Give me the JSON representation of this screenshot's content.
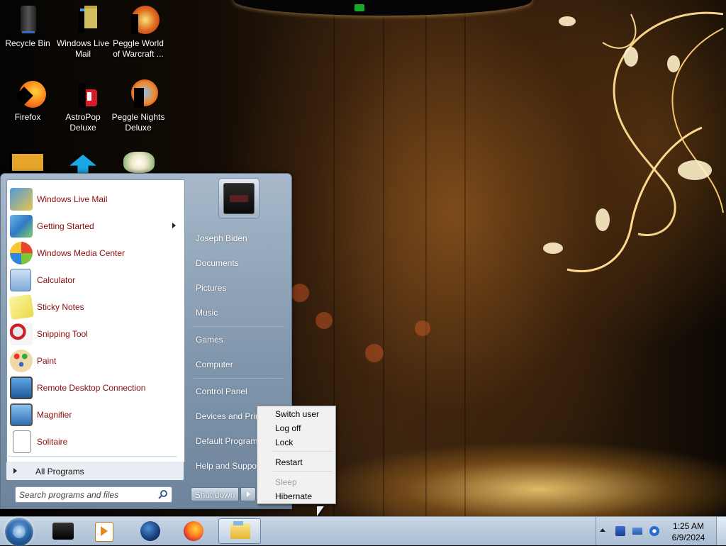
{
  "desktop": {
    "icons": [
      {
        "label": "Recycle Bin",
        "icon": "recycle-bin-icon"
      },
      {
        "label": "Windows Live\nMail",
        "icon": "windows-live-mail-icon"
      },
      {
        "label": "Peggle World\nof Warcraft ...",
        "icon": "peggle-wow-icon"
      },
      {
        "label": "Firefox",
        "icon": "firefox-icon"
      },
      {
        "label": "AstroPop\nDeluxe",
        "icon": "astropop-icon"
      },
      {
        "label": "Peggle Nights\nDeluxe",
        "icon": "peggle-nights-icon"
      }
    ]
  },
  "start_menu": {
    "programs": [
      {
        "label": "Windows Live Mail",
        "icon": "windows-live-mail-icon",
        "submenu": false
      },
      {
        "label": "Getting Started",
        "icon": "getting-started-icon",
        "submenu": true
      },
      {
        "label": "Windows Media Center",
        "icon": "media-center-icon",
        "submenu": false
      },
      {
        "label": "Calculator",
        "icon": "calculator-icon",
        "submenu": false
      },
      {
        "label": "Sticky Notes",
        "icon": "sticky-notes-icon",
        "submenu": false
      },
      {
        "label": "Snipping Tool",
        "icon": "snipping-tool-icon",
        "submenu": false
      },
      {
        "label": "Paint",
        "icon": "paint-icon",
        "submenu": false
      },
      {
        "label": "Remote Desktop Connection",
        "icon": "remote-desktop-icon",
        "submenu": false
      },
      {
        "label": "Magnifier",
        "icon": "magnifier-icon",
        "submenu": false
      },
      {
        "label": "Solitaire",
        "icon": "solitaire-icon",
        "submenu": false
      }
    ],
    "all_programs_label": "All Programs",
    "search_placeholder": "Search programs and files",
    "right_links": [
      "Joseph Biden",
      "Documents",
      "Pictures",
      "Music",
      "Games",
      "Computer",
      "Control Panel",
      "Devices and Printers",
      "Default Programs",
      "Help and Support"
    ],
    "shutdown_label": "Shut down"
  },
  "power_menu": {
    "items": [
      {
        "label": "Switch user",
        "enabled": true
      },
      {
        "label": "Log off",
        "enabled": true
      },
      {
        "label": "Lock",
        "enabled": true
      },
      {
        "label": "Restart",
        "enabled": true
      },
      {
        "label": "Sleep",
        "enabled": false
      },
      {
        "label": "Hibernate",
        "enabled": true
      }
    ]
  },
  "taskbar": {
    "pinned": [
      {
        "name": "taskbar-dark-app",
        "icon": "black-box-icon"
      },
      {
        "name": "taskbar-media-player",
        "icon": "media-player-icon"
      },
      {
        "name": "taskbar-globe-app",
        "icon": "globe-icon"
      },
      {
        "name": "taskbar-firefox",
        "icon": "firefox-icon"
      },
      {
        "name": "taskbar-explorer",
        "icon": "explorer-icon"
      }
    ],
    "clock": {
      "time": "1:25 AM",
      "date": "6/9/2024"
    }
  },
  "colors": {
    "program_label": "#8a0b0b",
    "menu_blue": "#8197ad"
  }
}
